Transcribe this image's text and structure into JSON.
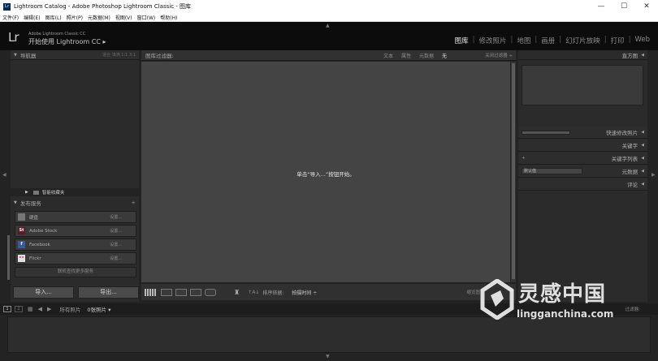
{
  "window": {
    "title": "Lightroom Catalog - Adobe Photoshop Lightroom Classic - 图库",
    "app_icon": "Lr",
    "controls": [
      "—",
      "☐",
      "✕"
    ]
  },
  "menu": [
    "文件(F)",
    "编辑(E)",
    "图库(L)",
    "照片(P)",
    "元数据(M)",
    "视图(V)",
    "窗口(W)",
    "帮助(H)"
  ],
  "identity": {
    "logo": "Lr",
    "line1": "Adobe Lightroom Classic CC",
    "line2": "开始使用 Lightroom CC",
    "arrow": "▸"
  },
  "modules": [
    {
      "label": "图库",
      "active": true
    },
    {
      "label": "修改照片",
      "active": false
    },
    {
      "label": "地图",
      "active": false
    },
    {
      "label": "画册",
      "active": false
    },
    {
      "label": "幻灯片放映",
      "active": false
    },
    {
      "label": "打印",
      "active": false
    },
    {
      "label": "Web",
      "active": false
    }
  ],
  "module_separator": "|",
  "left_panel": {
    "navigator": {
      "title": "导航器",
      "options": "适合  填满  1:1  3:1",
      "toggle": "▼"
    },
    "collections": {
      "toggle": "▶",
      "label": "智能收藏夹"
    },
    "publish": {
      "title": "发布服务",
      "toggle": "▼",
      "add": "+"
    },
    "services": [
      {
        "icon": "hard-drive-icon",
        "icon_text": "",
        "icon_color": "#777777",
        "label": "硬盘",
        "action": "设置..."
      },
      {
        "icon": "adobe-stock-icon",
        "icon_text": "St",
        "icon_color": "#5a1a2a",
        "label": "Adobe Stock",
        "action": "设置..."
      },
      {
        "icon": "facebook-icon",
        "icon_text": "f",
        "icon_color": "#3b5998",
        "label": "Facebook",
        "action": "设置..."
      },
      {
        "icon": "flickr-icon",
        "icon_text": "••",
        "icon_color": "#e0e0e0",
        "label": "Flickr",
        "action": "设置..."
      }
    ],
    "find_more": "联机查找更多服务",
    "import_button": "导入...",
    "export_button": "导出..."
  },
  "filter_bar": {
    "label": "图库过滤器:",
    "options": [
      {
        "label": "文本",
        "on": false
      },
      {
        "label": "属性",
        "on": false
      },
      {
        "label": "元数据",
        "on": false
      },
      {
        "label": "无",
        "on": true
      }
    ],
    "close_label": "关闭过滤器 ÷"
  },
  "grid": {
    "empty_message": "单击“导入...”按钮开始。"
  },
  "toolbar": {
    "spray_icon": "spray-can-icon",
    "sort_label": "排序依据:",
    "sort_value": "拍摄时间 ÷",
    "thumbnails_label": "缩览图"
  },
  "right_panel": {
    "histogram": {
      "title": "直方图",
      "toggle": "◀"
    },
    "rows": [
      {
        "label": "快速修改照片",
        "toggle": "◀",
        "left": "slider"
      },
      {
        "label": "关键字",
        "toggle": "◀",
        "left": ""
      },
      {
        "label": "关键字列表",
        "toggle": "◀",
        "left": "+"
      },
      {
        "label": "元数据",
        "toggle": "◀",
        "left": "默认值"
      },
      {
        "label": "评论",
        "toggle": "◀",
        "left": ""
      }
    ]
  },
  "filmstrip": {
    "monitor1": "1",
    "monitor2": "2",
    "source": "所有照片",
    "count": "0张照片 ▾",
    "filter_label": "过滤器:"
  },
  "watermark": {
    "cn": "灵感中国",
    "en": "lingganchina.com"
  }
}
